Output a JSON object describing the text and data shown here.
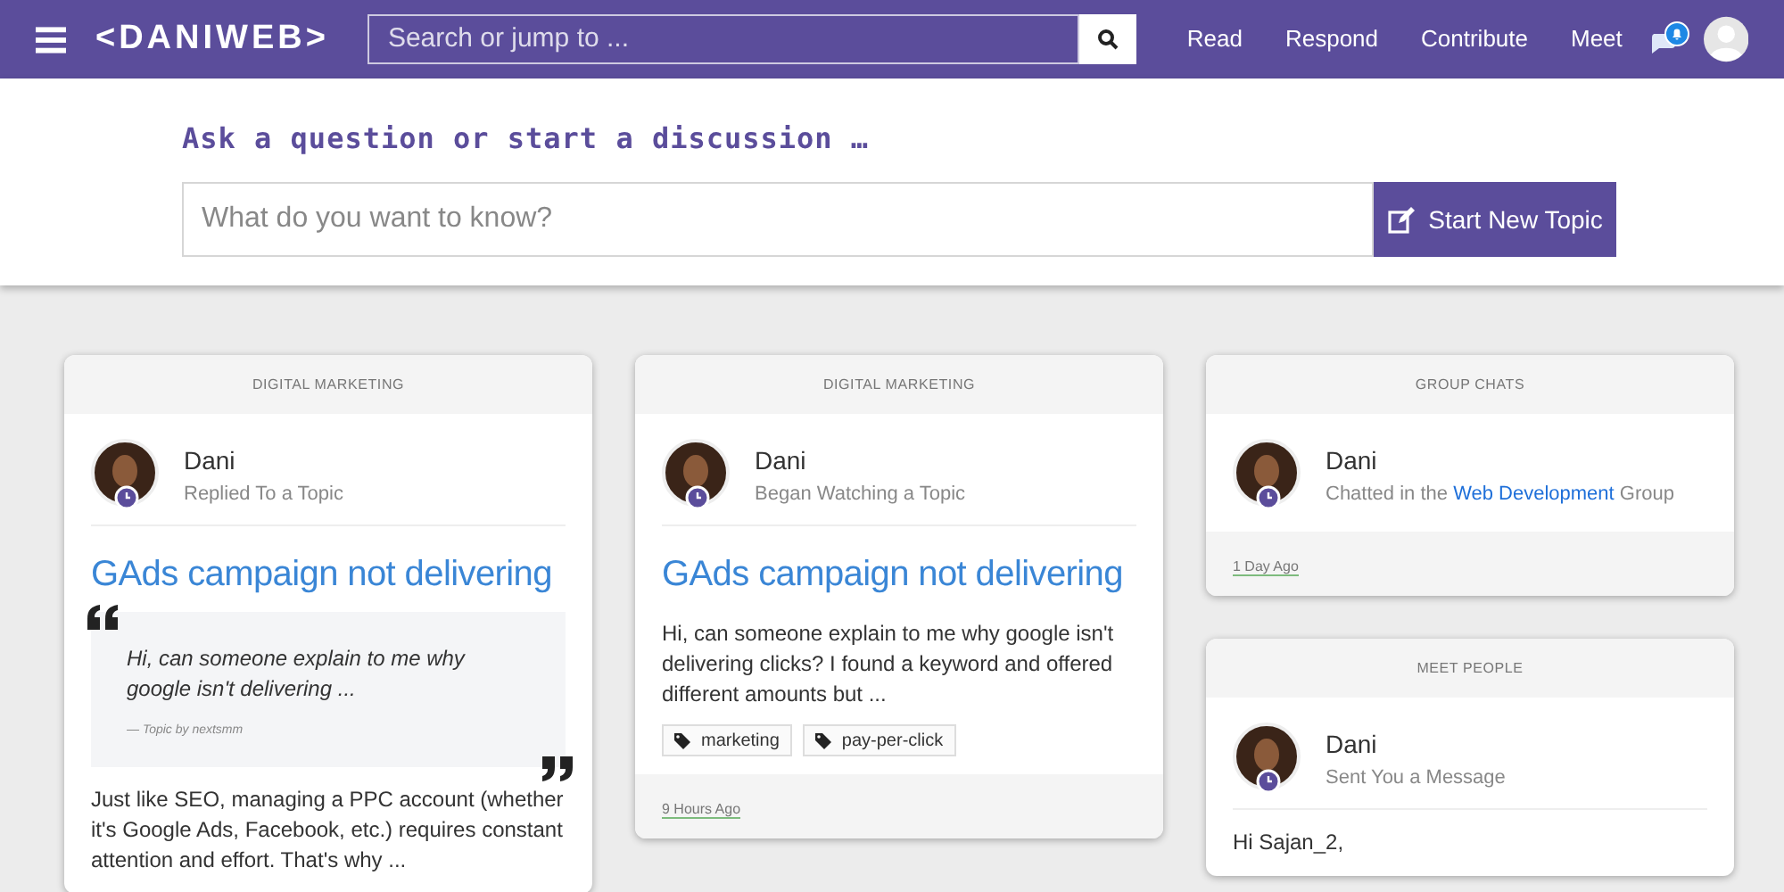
{
  "navbar": {
    "logo": "<DANIWEB>",
    "search": {
      "placeholder": "Search or jump to ..."
    },
    "links": [
      "Read",
      "Respond",
      "Contribute",
      "Meet"
    ],
    "notification": true
  },
  "ask": {
    "heading": "Ask a question or start a discussion …",
    "placeholder": "What do you want to know?",
    "button": "Start New Topic"
  },
  "columns": [
    {
      "cards": [
        {
          "category": "DIGITAL MARKETING",
          "author": "Dani",
          "action": [
            {
              "kind": "plain",
              "text": "Replied To a Topic"
            }
          ],
          "blocks": [
            {
              "kind": "title",
              "text": "GAds campaign not delivering"
            },
            {
              "kind": "quote",
              "text": "Hi, can someone explain to me why google isn't delivering ...",
              "attribution": "— Topic by nextsmm"
            },
            {
              "kind": "paragraph",
              "text": "Just like SEO, managing a PPC account (whether it's Google Ads, Facebook, etc.) requires constant attention and effort. That's why ..."
            }
          ]
        }
      ]
    },
    {
      "cards": [
        {
          "category": "DIGITAL MARKETING",
          "author": "Dani",
          "action": [
            {
              "kind": "plain",
              "text": "Began Watching a Topic"
            }
          ],
          "blocks": [
            {
              "kind": "title",
              "text": "GAds campaign not delivering"
            },
            {
              "kind": "paragraph",
              "text": "Hi, can someone explain to me why google isn't delivering clicks? I found a keyword and offered different amounts but ..."
            },
            {
              "kind": "tags",
              "tags": [
                "marketing",
                "pay-per-click"
              ]
            }
          ],
          "time": "9 Hours Ago"
        }
      ]
    },
    {
      "cards": [
        {
          "category": "GROUP CHATS",
          "author": "Dani",
          "action": [
            {
              "kind": "plain",
              "text": "Chatted in the "
            },
            {
              "kind": "link",
              "text": "Web Development"
            },
            {
              "kind": "plain",
              "text": " Group"
            }
          ],
          "time": "1 Day Ago"
        },
        {
          "category": "MEET PEOPLE",
          "author": "Dani",
          "action": [
            {
              "kind": "plain",
              "text": "Sent You a Message"
            }
          ],
          "blocks": [
            {
              "kind": "paragraph",
              "text": "Hi Sajan_2,"
            }
          ]
        }
      ]
    }
  ]
}
